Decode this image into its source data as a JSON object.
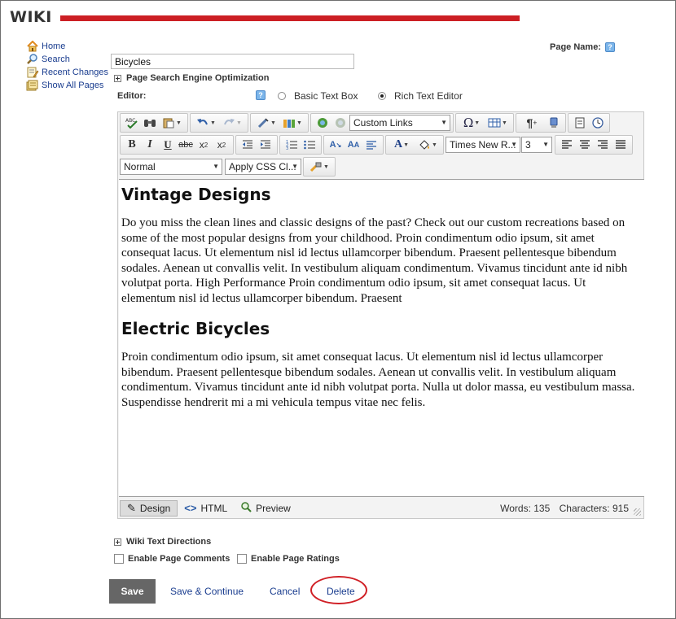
{
  "header": {
    "title": "WIKI",
    "accent_color": "#cc1f24"
  },
  "nav": {
    "items": [
      {
        "label": "Home",
        "icon": "home-icon"
      },
      {
        "label": "Search",
        "icon": "search-icon"
      },
      {
        "label": "Recent Changes",
        "icon": "recent-changes-icon"
      },
      {
        "label": "Show All Pages",
        "icon": "pages-icon"
      }
    ]
  },
  "page_name": {
    "label": "Page Name:",
    "value": "Bicycles",
    "help_glyph": "?"
  },
  "seo": {
    "label": "Page Search Engine Optimization"
  },
  "editor_mode": {
    "label": "Editor:",
    "options": [
      {
        "label": "Basic Text Box",
        "selected": false
      },
      {
        "label": "Rich Text Editor",
        "selected": true
      }
    ]
  },
  "toolbar": {
    "link_select": "Custom Links",
    "font_family": "Times New R...",
    "font_size": "3",
    "paragraph_style": "Normal",
    "css_class": "Apply CSS Cl..."
  },
  "content": {
    "sections": [
      {
        "heading": "Vintage Designs",
        "body": "Do you miss the clean lines and classic designs of the past? Check out our custom recreations based on some of the most popular designs from your childhood. Proin condimentum odio ipsum, sit amet consequat lacus. Ut elementum nisl id lectus ullamcorper bibendum. Praesent pellentesque bibendum sodales. Aenean ut convallis velit. In vestibulum aliquam condimentum. Vivamus tincidunt ante id nibh volutpat porta. High Performance Proin condimentum odio ipsum, sit amet consequat lacus. Ut elementum nisl id lectus ullamcorper bibendum. Praesent"
      },
      {
        "heading": "Electric Bicycles",
        "body": "Proin condimentum odio ipsum, sit amet consequat lacus. Ut elementum nisl id lectus ullamcorper bibendum. Praesent pellentesque bibendum sodales. Aenean ut convallis velit. In vestibulum aliquam condimentum. Vivamus tincidunt ante id nibh volutpat porta. Nulla ut dolor massa, eu vestibulum massa. Suspendisse hendrerit mi a mi vehicula tempus vitae nec felis."
      }
    ]
  },
  "modes": {
    "design": "Design",
    "html": "HTML",
    "preview": "Preview"
  },
  "stats": {
    "words": "Words: 135",
    "characters": "Characters: 915"
  },
  "directions": {
    "label": "Wiki Text Directions"
  },
  "options": {
    "comments": "Enable Page Comments",
    "ratings": "Enable Page Ratings"
  },
  "actions": {
    "save": "Save",
    "save_continue": "Save & Continue",
    "cancel": "Cancel",
    "delete": "Delete",
    "highlight_color": "#d01f25"
  }
}
